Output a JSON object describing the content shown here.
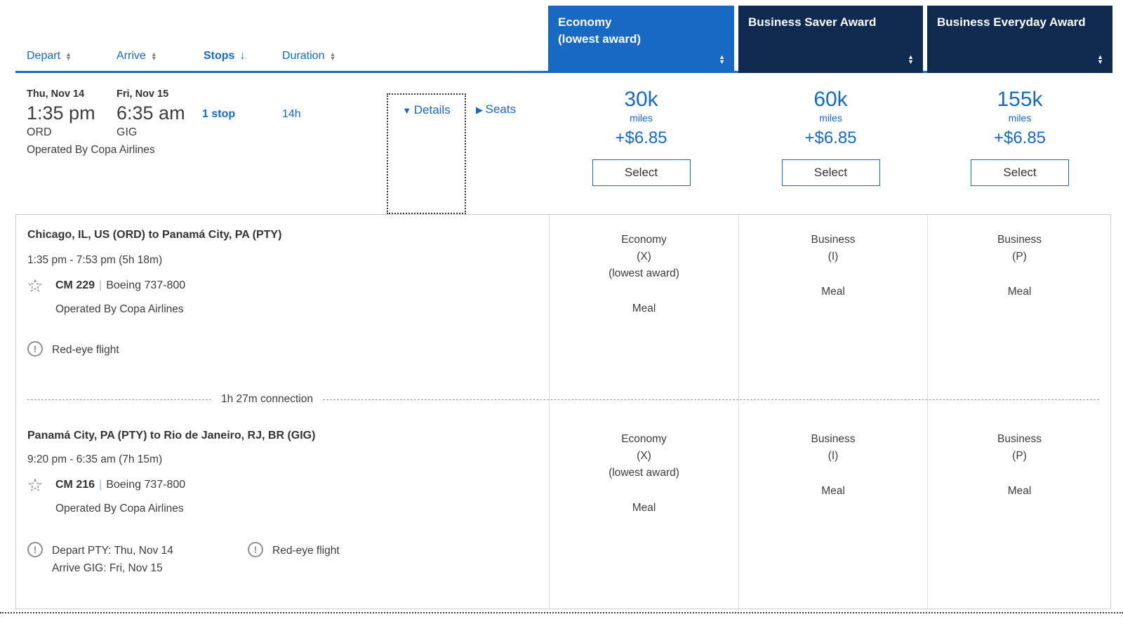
{
  "colors": {
    "accent_blue": "#1769c4",
    "economy_header_bg": "#1769c4",
    "business_header_bg": "#0e2a50"
  },
  "sort_bar": {
    "columns": [
      {
        "label": "Depart",
        "sort": "both"
      },
      {
        "label": "Arrive",
        "sort": "both"
      },
      {
        "label": "Stops",
        "sort": "desc"
      },
      {
        "label": "Duration",
        "sort": "both"
      }
    ]
  },
  "fare_headers": [
    {
      "line1": "Economy",
      "line2": "(lowest award)"
    },
    {
      "line1": "Business Saver Award",
      "line2": ""
    },
    {
      "line1": "Business Everyday Award",
      "line2": ""
    }
  ],
  "summary": {
    "depart_date": "Thu, Nov 14",
    "depart_time": "1:35 pm",
    "depart_airport": "ORD",
    "arrive_date": "Fri, Nov 15",
    "arrive_time": "6:35 am",
    "arrive_airport": "GIG",
    "stops": "1 stop",
    "duration": "14h",
    "operated_by": "Operated By Copa Airlines",
    "details_label": "Details",
    "seats_label": "Seats"
  },
  "fares": [
    {
      "miles": "30k",
      "miles_unit": "miles",
      "fees": "+$6.85",
      "select_label": "Select"
    },
    {
      "miles": "60k",
      "miles_unit": "miles",
      "fees": "+$6.85",
      "select_label": "Select"
    },
    {
      "miles": "155k",
      "miles_unit": "miles",
      "fees": "+$6.85",
      "select_label": "Select"
    }
  ],
  "details": {
    "connection": "1h 27m connection",
    "segments": [
      {
        "route": "Chicago, IL, US (ORD) to Panamá City, PA (PTY)",
        "times": "1:35 pm - 7:53 pm (5h 18m)",
        "flight_number": "CM 229",
        "separator": "|",
        "aircraft": "Boeing 737-800",
        "operated_by": "Operated By Copa Airlines",
        "warnings": [
          {
            "line1": "Red-eye flight",
            "line2": ""
          }
        ],
        "cabins": [
          {
            "line1": "Economy",
            "line2": "(X)",
            "line3": "(lowest award)",
            "meal": "Meal"
          },
          {
            "line1": "Business",
            "line2": "(I)",
            "line3": "",
            "meal": "Meal"
          },
          {
            "line1": "Business",
            "line2": "(P)",
            "line3": "",
            "meal": "Meal"
          }
        ]
      },
      {
        "route": "Panamá City, PA (PTY) to Rio de Janeiro, RJ, BR (GIG)",
        "times": "9:20 pm - 6:35 am (7h 15m)",
        "flight_number": "CM 216",
        "separator": "|",
        "aircraft": "Boeing 737-800",
        "operated_by": "Operated By Copa Airlines",
        "warnings": [
          {
            "line1": "Depart PTY: Thu, Nov 14",
            "line2": "Arrive GIG: Fri, Nov 15"
          },
          {
            "line1": "Red-eye flight",
            "line2": ""
          }
        ],
        "cabins": [
          {
            "line1": "Economy",
            "line2": "(X)",
            "line3": "(lowest award)",
            "meal": "Meal"
          },
          {
            "line1": "Business",
            "line2": "(I)",
            "line3": "",
            "meal": "Meal"
          },
          {
            "line1": "Business",
            "line2": "(P)",
            "line3": "",
            "meal": "Meal"
          }
        ]
      }
    ]
  }
}
